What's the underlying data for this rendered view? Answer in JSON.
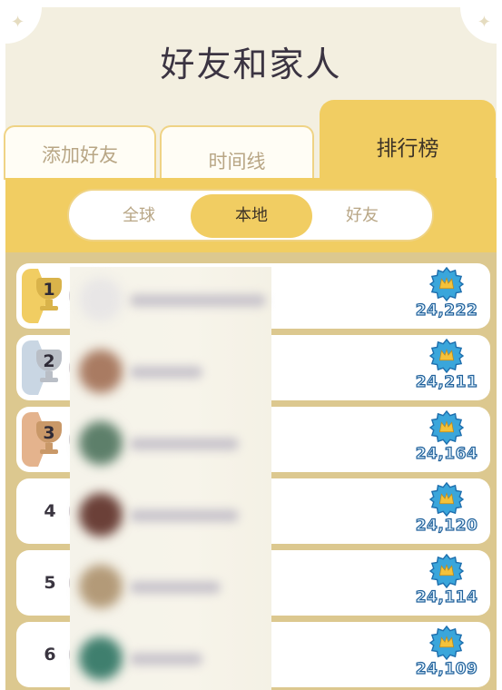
{
  "header": {
    "title": "好友和家人",
    "corner_icon": "leaf-ornament-icon"
  },
  "tabs": [
    {
      "label": "添加好友",
      "active": false
    },
    {
      "label": "时间线",
      "active": false
    },
    {
      "label": "排行榜",
      "active": true
    }
  ],
  "scope_filter": {
    "options": [
      {
        "label": "全球",
        "active": false
      },
      {
        "label": "本地",
        "active": true
      },
      {
        "label": "好友",
        "active": false
      }
    ]
  },
  "leaderboard": {
    "score_icon": "blue-star-medal-icon",
    "rows": [
      {
        "rank": "1",
        "badge": "gold-trophy-icon",
        "badge_color": "#f1cd62",
        "cup_color": "#d9b34a",
        "score": "24,222",
        "avatar_color": "#e8e6e6",
        "name_blur": "redacted"
      },
      {
        "rank": "2",
        "badge": "silver-trophy-icon",
        "badge_color": "#c9d6e3",
        "cup_color": "#b9bec6",
        "score": "24,211",
        "avatar_color": "#a97b62",
        "name_blur": "redacted"
      },
      {
        "rank": "3",
        "badge": "bronze-trophy-icon",
        "badge_color": "#e4b38d",
        "cup_color": "#c99868",
        "score": "24,164",
        "avatar_color": "#5d7f6a",
        "name_blur": "redacted"
      },
      {
        "rank": "4",
        "badge": null,
        "score": "24,120",
        "avatar_color": "#6b4038",
        "name_blur": "redacted"
      },
      {
        "rank": "5",
        "badge": null,
        "score": "24,114",
        "avatar_color": "#b39a78",
        "name_blur": "redacted"
      },
      {
        "rank": "6",
        "badge": null,
        "score": "24,109",
        "avatar_color": "#3f7f6e",
        "name_blur": "redacted"
      }
    ]
  },
  "colors": {
    "accent_yellow": "#f1cd62",
    "panel_bg": "#f3efe0",
    "list_bg": "#dcc88f",
    "score_outline": "#1e5f9a",
    "medal_blue": "#3aa6db",
    "medal_gold": "#f4c23a"
  }
}
